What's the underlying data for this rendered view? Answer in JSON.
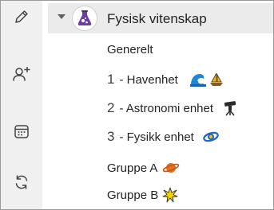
{
  "team": {
    "name": "Fysisk vitenskap",
    "avatar_icon": "science-flask-icon"
  },
  "rail": {
    "icons": [
      "pencil-icon",
      "add-person-icon",
      "calendar-icon",
      "sync-icon"
    ]
  },
  "channels": [
    {
      "label": "Generelt"
    },
    {
      "number": "1",
      "label": "- Havenhet",
      "emoji": [
        "wave-emoji",
        "sailboat-emoji"
      ]
    },
    {
      "number": "2",
      "label": "- Astronomi enhet",
      "emoji": [
        "telescope-emoji"
      ]
    },
    {
      "number": "3",
      "label": "- Fysikk enhet",
      "emoji": [
        "atom-emoji"
      ]
    },
    {
      "label": "Gruppe A",
      "emoji": [
        "ringed-planet-emoji"
      ]
    },
    {
      "label": "Gruppe B",
      "emoji": [
        "sparkle-star-emoji"
      ]
    }
  ],
  "colors": {
    "rail_bg": "#f0f0f0",
    "selected_row_bg": "#ebebeb",
    "accent_purple": "#6b3fa0"
  }
}
